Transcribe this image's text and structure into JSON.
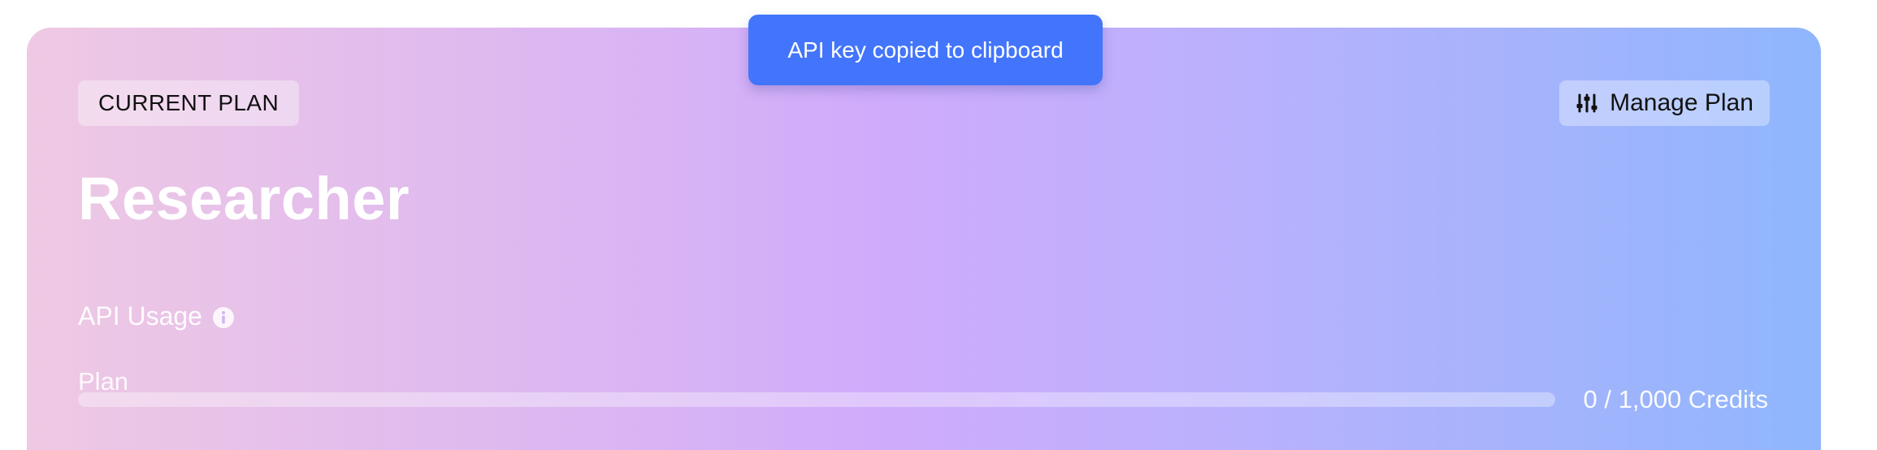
{
  "toast": {
    "message": "API key copied to clipboard"
  },
  "plan_card": {
    "badge_label": "CURRENT PLAN",
    "manage_button_label": "Manage Plan",
    "manage_button_icon": "sliders-icon",
    "plan_name": "Researcher",
    "usage": {
      "title": "API Usage",
      "info_icon": "info-icon",
      "subtitle": "Plan",
      "used": 0,
      "total": 1000,
      "progress_fraction": 0,
      "credits_text": "0 / 1,000 Credits"
    },
    "colors": {
      "gradient_start": "#efc9e3",
      "gradient_mid": "#d0abfb",
      "gradient_end": "#8fb6fd",
      "toast_bg": "#4275fb"
    }
  }
}
